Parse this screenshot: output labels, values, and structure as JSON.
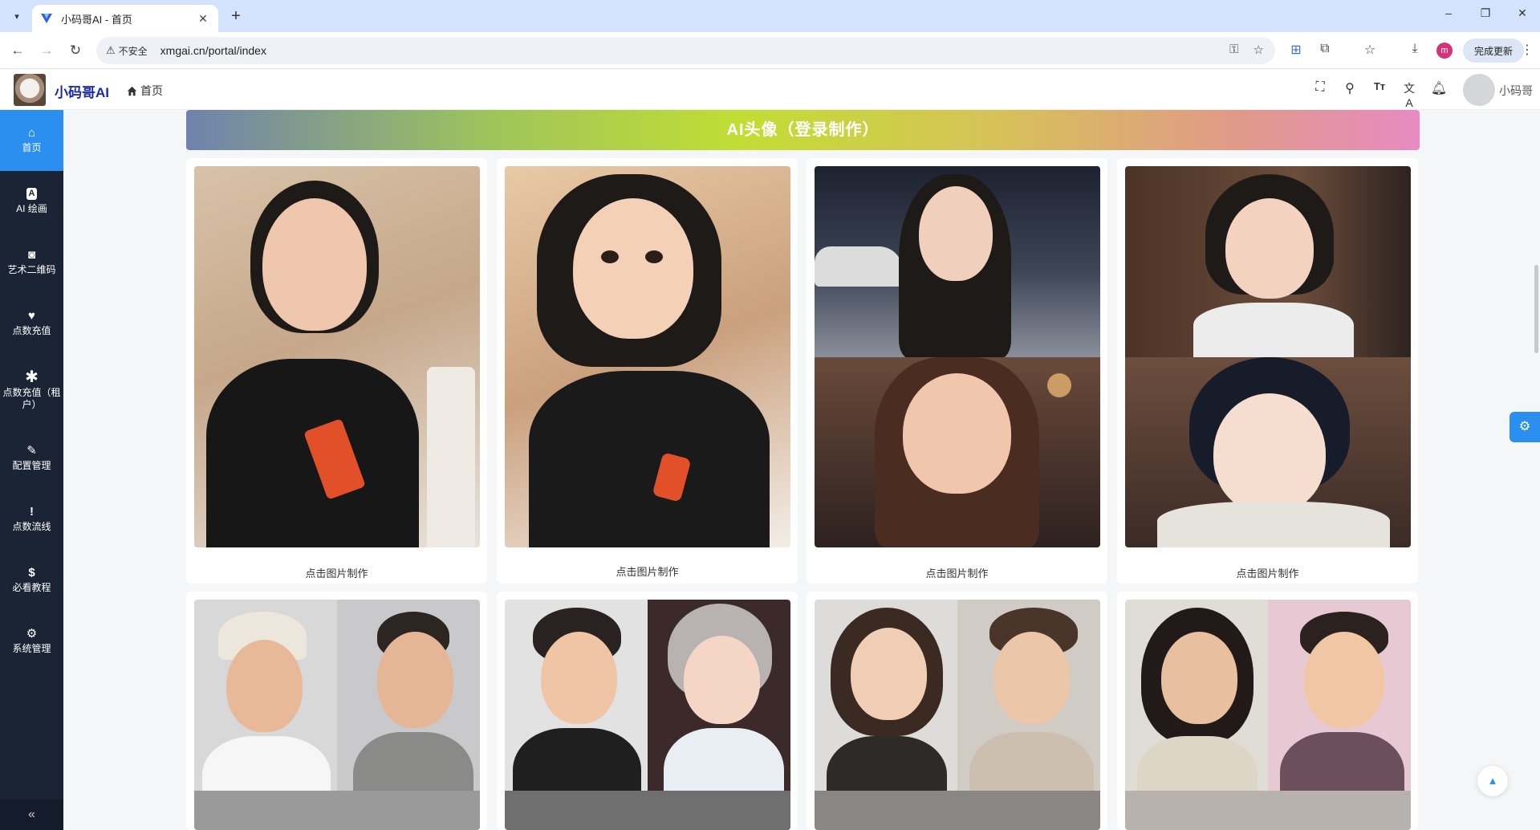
{
  "browser": {
    "tab_title": "小码哥AI - 首页",
    "insecure_label": "不安全",
    "url": "xmgai.cn/portal/index",
    "profile_initial": "m",
    "update_label": "完成更新"
  },
  "header": {
    "brand": "小码哥AI",
    "breadcrumb": "首页",
    "username": "小码哥"
  },
  "sidebar": {
    "items": [
      {
        "label": "首页",
        "icon": "home-icon"
      },
      {
        "label": "AI 绘画",
        "icon": "ai-icon"
      },
      {
        "label": "艺术二维码",
        "icon": "camera-icon"
      },
      {
        "label": "点数充值",
        "icon": "heart-icon"
      },
      {
        "label": "点数充值（租户）",
        "icon": "asterisk-icon"
      },
      {
        "label": "配置管理",
        "icon": "pencil-icon"
      },
      {
        "label": "点数流线",
        "icon": "exclamation-icon"
      },
      {
        "label": "必看教程",
        "icon": "dollar-icon"
      },
      {
        "label": "系统管理",
        "icon": "gear-icon"
      }
    ]
  },
  "banner": {
    "title": "AI头像（登录制作）"
  },
  "cards": [
    {
      "caption": "点击图片制作"
    },
    {
      "caption": "点击图片制作"
    },
    {
      "caption": "点击图片制作"
    },
    {
      "caption": "点击图片制作"
    }
  ],
  "colors": {
    "accent": "#2b8ff0",
    "sidebar_bg": "#1b2435",
    "brand": "#1a2aa8"
  }
}
